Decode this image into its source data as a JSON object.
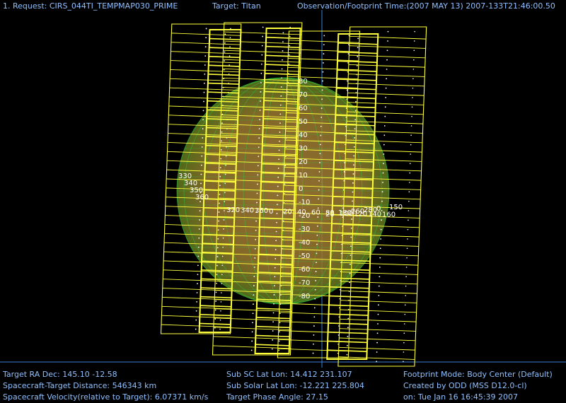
{
  "header": {
    "request": "1. Request:  CIRS_044TI_TEMPMAP030_PRIME",
    "target": "Target: Titan",
    "obs_time": "Observation/Footprint Time:(2007 MAY 13) 2007-133T21:46:00.50"
  },
  "footer": {
    "ra_dec": "Target RA  Dec: 145.10   -12.58",
    "distance": "Spacecraft-Target Distance:  546343 km",
    "velocity": "Spacecraft Velocity(relative to Target): 6.07371 km/s",
    "sub_sc": "Sub SC Lat Lon: 14.412  231.107",
    "sub_solar": "Sub Solar Lat Lon: -12.221   225.804",
    "phase": "Target Phase Angle: 27.15",
    "fp_mode": "Footprint Mode: Body Center (Default)",
    "created_by": "Created by ODD (MSS D12.0-cl)",
    "created_on": "on: Tue Jan 16 16:45:39 2007"
  },
  "colors": {
    "footprint": "#ffff3c",
    "footprint_dim": "#ffffff",
    "disk": "#9c7a2a",
    "grid": "#2ecc40",
    "axis": "#3d7fd8",
    "text": "#8fc0ff"
  },
  "grid_labels": {
    "lat_labels": [
      "80",
      "70",
      "60",
      "50",
      "40",
      "30",
      "20",
      "10",
      "0",
      "-10",
      "-20",
      "-30",
      "-40",
      "-50",
      "-60",
      "-70",
      "-80"
    ],
    "lon_labels": [
      "320",
      "340",
      "360",
      "0",
      "20",
      "40",
      "60",
      "80",
      "100",
      "120",
      "140",
      "160"
    ],
    "left_lon": [
      "330",
      "340",
      "350",
      "360"
    ],
    "equator_lon": [
      "20",
      "180",
      "260",
      "280",
      "0",
      "150"
    ]
  }
}
